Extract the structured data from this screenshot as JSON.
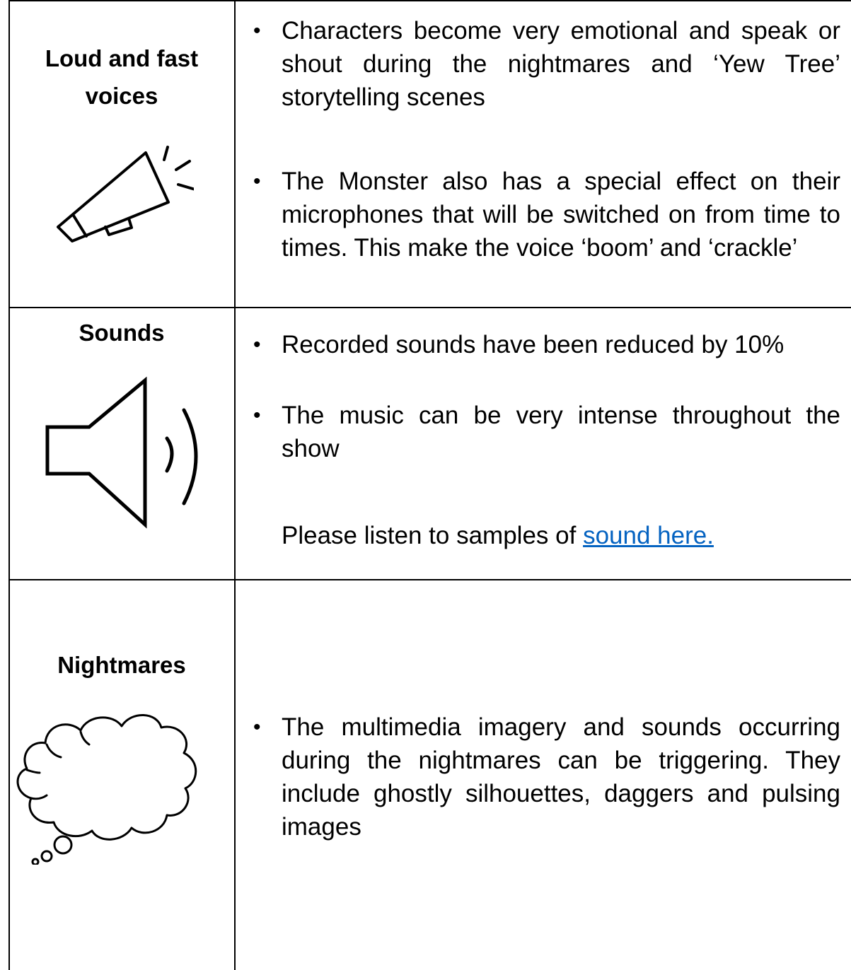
{
  "rows": [
    {
      "heading_lines": [
        "Loud and fast",
        "voices"
      ],
      "icon": "megaphone-icon",
      "bullets": [
        "Characters become very emotional and speak or shout during the nightmares and ‘Yew Tree’ storytelling scenes",
        "The Monster also has a special effect on their microphones that will be switched on from time to times. This make the voice ‘boom’ and ‘crackle’"
      ]
    },
    {
      "heading_lines": [
        "Sounds"
      ],
      "icon": "speaker-icon",
      "bullets": [
        "Recorded sounds have been reduced by 10%",
        "The music can be very intense throughout the show"
      ],
      "note_prefix": "Please listen to samples of ",
      "note_link": "sound here."
    },
    {
      "heading_lines": [
        "Nightmares"
      ],
      "icon": "thought-cloud-icon",
      "bullets": [
        "The multimedia imagery and sounds occurring during the nightmares can be triggering. They include ghostly silhouettes, daggers and pulsing images"
      ]
    }
  ],
  "bullet_glyph": "•"
}
